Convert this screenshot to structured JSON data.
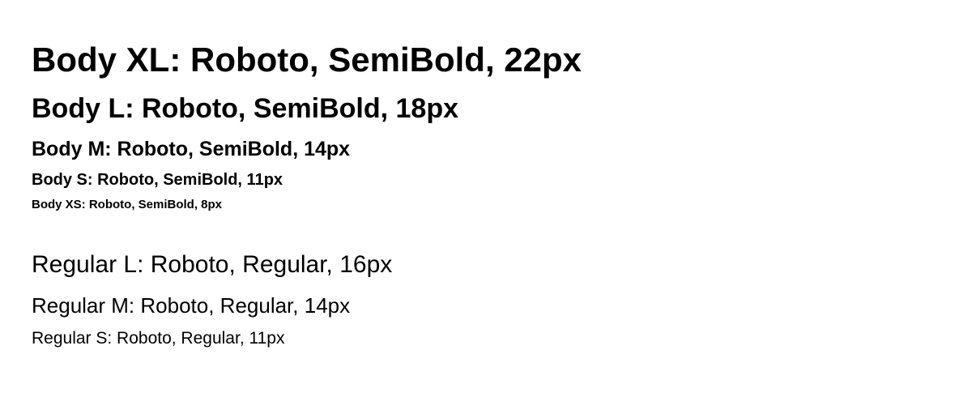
{
  "semibold_samples": {
    "xl": "Body XL: Roboto, SemiBold, 22px",
    "l": "Body L: Roboto, SemiBold, 18px",
    "m": "Body M: Roboto, SemiBold, 14px",
    "s": "Body S: Roboto, SemiBold, 11px",
    "xs": "Body XS: Roboto, SemiBold, 8px"
  },
  "regular_samples": {
    "l": "Regular L: Roboto, Regular, 16px",
    "m": "Regular M: Roboto, Regular, 14px",
    "s": "Regular S: Roboto, Regular, 11px"
  },
  "colors": {
    "background": "#ffffff",
    "text": "#000000"
  }
}
